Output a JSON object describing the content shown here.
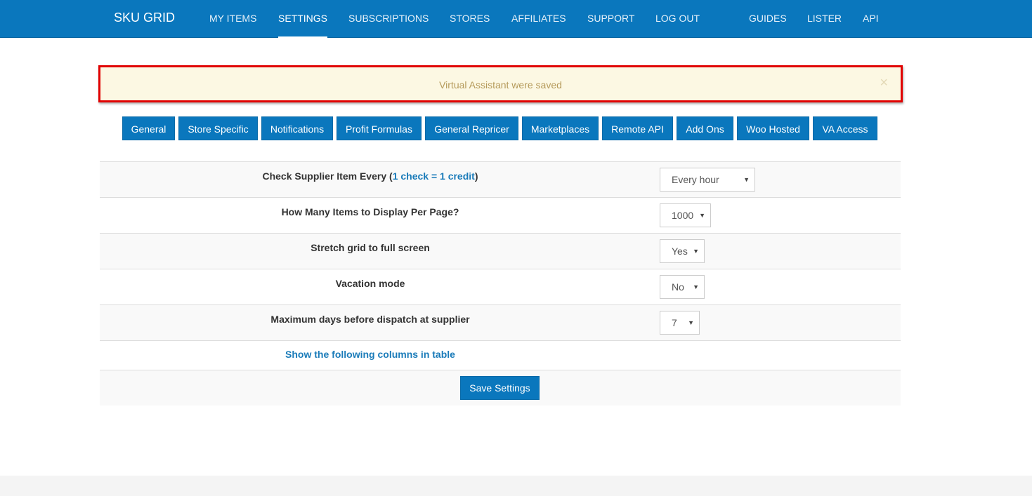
{
  "navbar": {
    "brand": "SKU GRID",
    "items": [
      "MY ITEMS",
      "SETTINGS",
      "SUBSCRIPTIONS",
      "STORES",
      "AFFILIATES",
      "SUPPORT",
      "LOG OUT",
      "GUIDES",
      "LISTER",
      "API"
    ],
    "active": "SETTINGS"
  },
  "alert": {
    "message": "Virtual Assistant were saved",
    "close_symbol": "×"
  },
  "tabs": [
    "General",
    "Store Specific",
    "Notifications",
    "Profit Formulas",
    "General Repricer",
    "Marketplaces",
    "Remote API",
    "Add Ons",
    "Woo Hosted",
    "VA Access"
  ],
  "settings": [
    {
      "label": "Check Supplier Item Every",
      "label_link": "1 check = 1 credit",
      "value": "Every hour"
    },
    {
      "label": "How Many Items to Display Per Page?",
      "value": "1000"
    },
    {
      "label": "Stretch grid to full screen",
      "value": "Yes"
    },
    {
      "label": "Vacation mode",
      "value": "No"
    },
    {
      "label": "Maximum days before dispatch at supplier",
      "value": "7"
    }
  ],
  "columns_link": "Show the following columns in table",
  "save_label": "Save Settings",
  "colors": {
    "primary": "#0a77bd",
    "alert_bg": "#fcf8e3",
    "alert_text": "#b59a5a",
    "highlight_border": "#e10000",
    "link": "#1a7bb9"
  }
}
